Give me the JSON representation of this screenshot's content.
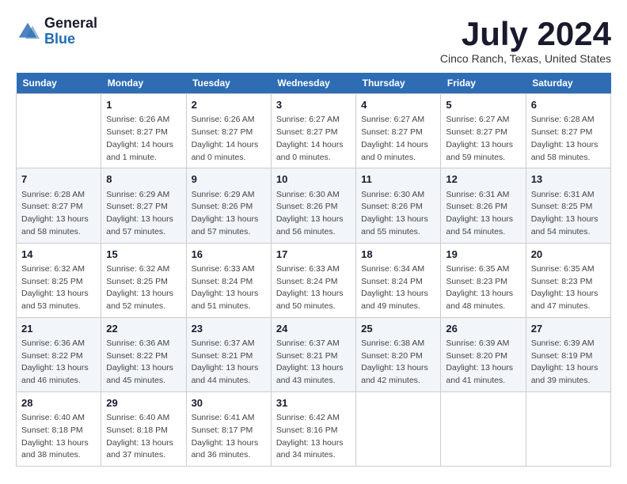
{
  "header": {
    "logo": {
      "text_general": "General",
      "text_blue": "Blue"
    },
    "title": "July 2024",
    "subtitle": "Cinco Ranch, Texas, United States"
  },
  "calendar": {
    "days_of_week": [
      "Sunday",
      "Monday",
      "Tuesday",
      "Wednesday",
      "Thursday",
      "Friday",
      "Saturday"
    ],
    "weeks": [
      [
        {
          "day": "",
          "info": ""
        },
        {
          "day": "1",
          "info": "Sunrise: 6:26 AM\nSunset: 8:27 PM\nDaylight: 14 hours\nand 1 minute."
        },
        {
          "day": "2",
          "info": "Sunrise: 6:26 AM\nSunset: 8:27 PM\nDaylight: 14 hours\nand 0 minutes."
        },
        {
          "day": "3",
          "info": "Sunrise: 6:27 AM\nSunset: 8:27 PM\nDaylight: 14 hours\nand 0 minutes."
        },
        {
          "day": "4",
          "info": "Sunrise: 6:27 AM\nSunset: 8:27 PM\nDaylight: 14 hours\nand 0 minutes."
        },
        {
          "day": "5",
          "info": "Sunrise: 6:27 AM\nSunset: 8:27 PM\nDaylight: 13 hours\nand 59 minutes."
        },
        {
          "day": "6",
          "info": "Sunrise: 6:28 AM\nSunset: 8:27 PM\nDaylight: 13 hours\nand 58 minutes."
        }
      ],
      [
        {
          "day": "7",
          "info": "Sunrise: 6:28 AM\nSunset: 8:27 PM\nDaylight: 13 hours\nand 58 minutes."
        },
        {
          "day": "8",
          "info": "Sunrise: 6:29 AM\nSunset: 8:27 PM\nDaylight: 13 hours\nand 57 minutes."
        },
        {
          "day": "9",
          "info": "Sunrise: 6:29 AM\nSunset: 8:26 PM\nDaylight: 13 hours\nand 57 minutes."
        },
        {
          "day": "10",
          "info": "Sunrise: 6:30 AM\nSunset: 8:26 PM\nDaylight: 13 hours\nand 56 minutes."
        },
        {
          "day": "11",
          "info": "Sunrise: 6:30 AM\nSunset: 8:26 PM\nDaylight: 13 hours\nand 55 minutes."
        },
        {
          "day": "12",
          "info": "Sunrise: 6:31 AM\nSunset: 8:26 PM\nDaylight: 13 hours\nand 54 minutes."
        },
        {
          "day": "13",
          "info": "Sunrise: 6:31 AM\nSunset: 8:25 PM\nDaylight: 13 hours\nand 54 minutes."
        }
      ],
      [
        {
          "day": "14",
          "info": "Sunrise: 6:32 AM\nSunset: 8:25 PM\nDaylight: 13 hours\nand 53 minutes."
        },
        {
          "day": "15",
          "info": "Sunrise: 6:32 AM\nSunset: 8:25 PM\nDaylight: 13 hours\nand 52 minutes."
        },
        {
          "day": "16",
          "info": "Sunrise: 6:33 AM\nSunset: 8:24 PM\nDaylight: 13 hours\nand 51 minutes."
        },
        {
          "day": "17",
          "info": "Sunrise: 6:33 AM\nSunset: 8:24 PM\nDaylight: 13 hours\nand 50 minutes."
        },
        {
          "day": "18",
          "info": "Sunrise: 6:34 AM\nSunset: 8:24 PM\nDaylight: 13 hours\nand 49 minutes."
        },
        {
          "day": "19",
          "info": "Sunrise: 6:35 AM\nSunset: 8:23 PM\nDaylight: 13 hours\nand 48 minutes."
        },
        {
          "day": "20",
          "info": "Sunrise: 6:35 AM\nSunset: 8:23 PM\nDaylight: 13 hours\nand 47 minutes."
        }
      ],
      [
        {
          "day": "21",
          "info": "Sunrise: 6:36 AM\nSunset: 8:22 PM\nDaylight: 13 hours\nand 46 minutes."
        },
        {
          "day": "22",
          "info": "Sunrise: 6:36 AM\nSunset: 8:22 PM\nDaylight: 13 hours\nand 45 minutes."
        },
        {
          "day": "23",
          "info": "Sunrise: 6:37 AM\nSunset: 8:21 PM\nDaylight: 13 hours\nand 44 minutes."
        },
        {
          "day": "24",
          "info": "Sunrise: 6:37 AM\nSunset: 8:21 PM\nDaylight: 13 hours\nand 43 minutes."
        },
        {
          "day": "25",
          "info": "Sunrise: 6:38 AM\nSunset: 8:20 PM\nDaylight: 13 hours\nand 42 minutes."
        },
        {
          "day": "26",
          "info": "Sunrise: 6:39 AM\nSunset: 8:20 PM\nDaylight: 13 hours\nand 41 minutes."
        },
        {
          "day": "27",
          "info": "Sunrise: 6:39 AM\nSunset: 8:19 PM\nDaylight: 13 hours\nand 39 minutes."
        }
      ],
      [
        {
          "day": "28",
          "info": "Sunrise: 6:40 AM\nSunset: 8:18 PM\nDaylight: 13 hours\nand 38 minutes."
        },
        {
          "day": "29",
          "info": "Sunrise: 6:40 AM\nSunset: 8:18 PM\nDaylight: 13 hours\nand 37 minutes."
        },
        {
          "day": "30",
          "info": "Sunrise: 6:41 AM\nSunset: 8:17 PM\nDaylight: 13 hours\nand 36 minutes."
        },
        {
          "day": "31",
          "info": "Sunrise: 6:42 AM\nSunset: 8:16 PM\nDaylight: 13 hours\nand 34 minutes."
        },
        {
          "day": "",
          "info": ""
        },
        {
          "day": "",
          "info": ""
        },
        {
          "day": "",
          "info": ""
        }
      ]
    ]
  }
}
